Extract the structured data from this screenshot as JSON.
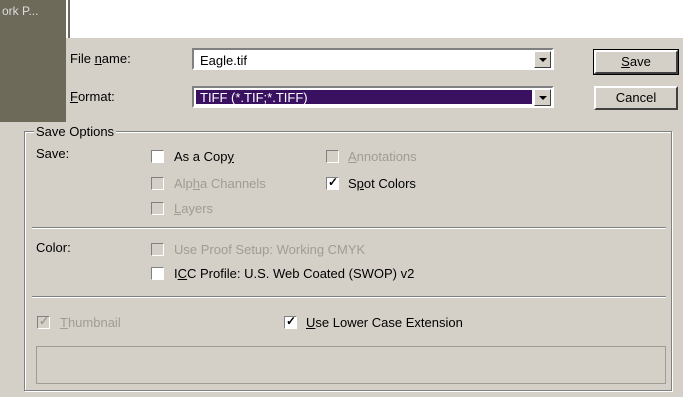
{
  "tab_label": "ork P...",
  "file_name": {
    "label_prefix": "File ",
    "label_key": "n",
    "label_suffix": "ame:",
    "value": "Eagle.tif"
  },
  "format": {
    "label_key": "F",
    "label_suffix": "ormat:",
    "value": "TIFF (*.TIF;*.TIFF)"
  },
  "buttons": {
    "save_key": "S",
    "save_rest": "ave",
    "cancel": "Cancel"
  },
  "save_options": {
    "legend": "Save Options",
    "save_label": "Save:",
    "color_label": "Color:",
    "as_copy": {
      "pre": "As a Cop",
      "key": "y",
      "post": "",
      "checked": false,
      "enabled": true
    },
    "annotations": {
      "pre": "",
      "key": "A",
      "post": "nnotations",
      "checked": false,
      "enabled": false
    },
    "alpha_channels": {
      "pre": "Alp",
      "key": "h",
      "post": "a Channels",
      "checked": false,
      "enabled": false
    },
    "spot_colors": {
      "pre": "S",
      "key": "p",
      "post": "ot Colors",
      "checked": true,
      "enabled": true
    },
    "layers": {
      "pre": "",
      "key": "L",
      "post": "ayers",
      "checked": false,
      "enabled": false
    },
    "use_proof_setup": {
      "text": "Use Proof Setup:  Working CMYK",
      "checked": false,
      "enabled": false
    },
    "icc_profile": {
      "pre": "I",
      "key": "C",
      "post": "C Profile:  U.S. Web Coated (SWOP) v2",
      "checked": false,
      "enabled": true
    }
  },
  "thumbnail": {
    "pre": "",
    "key": "T",
    "post": "humbnail",
    "checked": true,
    "enabled": false
  },
  "lower_case_ext": {
    "pre": "",
    "key": "U",
    "post": "se Lower Case Extension",
    "checked": true,
    "enabled": true
  }
}
